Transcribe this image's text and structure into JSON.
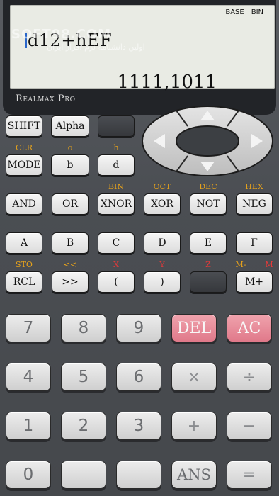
{
  "display": {
    "indicators": [
      "BASE",
      "BIN"
    ],
    "expression": "d12+hEF",
    "result": "1111,1011",
    "brand": "Realmax Pro",
    "watermark": "SOFT98.COM",
    "watermark_sub": "اولین دانشنامه نرم افزار ایران"
  },
  "top_row": {
    "shift": "SHIFT",
    "alpha": "Alpha",
    "blank": ""
  },
  "row2": {
    "labels": {
      "clr": "CLR",
      "o": "o",
      "h": "h"
    },
    "mode": "MODE",
    "b": "b",
    "d": "d"
  },
  "row3": {
    "labels": {
      "bin": "BIN",
      "oct": "OCT",
      "dec": "DEC",
      "hex": "HEX"
    },
    "keys": [
      "AND",
      "OR",
      "XNOR",
      "XOR",
      "NOT",
      "NEG"
    ]
  },
  "row4": {
    "keys": [
      "A",
      "B",
      "C",
      "D",
      "E",
      "F"
    ]
  },
  "row5": {
    "labels": {
      "sto": "STO",
      "shift_left": "<<",
      "x": "X",
      "y": "Y",
      "z": "Z",
      "m_minus": "M-",
      "m": "M"
    },
    "keys": [
      "RCL",
      ">>",
      "(",
      ")",
      "",
      "M+"
    ]
  },
  "keypad": {
    "row1": [
      "7",
      "8",
      "9",
      "DEL",
      "AC"
    ],
    "row2": [
      "4",
      "5",
      "6",
      "×",
      "÷"
    ],
    "row3": [
      "1",
      "2",
      "3",
      "+",
      "−"
    ],
    "row4": [
      "0",
      "",
      "",
      "ANS",
      "="
    ]
  },
  "colors": {
    "shift_label": "#e6a21c",
    "alpha_label": "#e23a3a",
    "red_key": "#e0798a",
    "lcd": "#e9ebe4"
  },
  "icons": {
    "up": "arrow-up-icon",
    "down": "arrow-down-icon",
    "left": "arrow-left-icon",
    "right": "arrow-right-icon"
  }
}
